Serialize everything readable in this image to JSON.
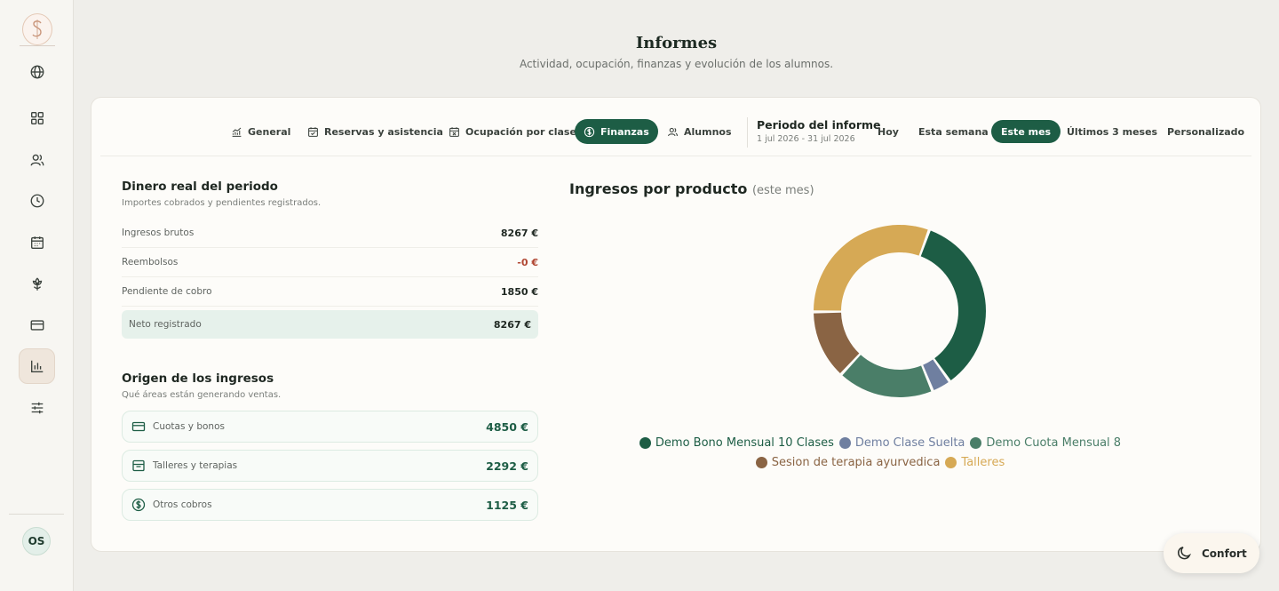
{
  "header": {
    "title": "Informes",
    "subtitle": "Actividad, ocupación, finanzas y evolución de los alumnos."
  },
  "sidebar": {
    "items": [
      {
        "icon": "globe-icon"
      },
      {
        "icon": "dashboard-icon"
      },
      {
        "icon": "users-icon"
      },
      {
        "icon": "clock-icon"
      },
      {
        "icon": "calendar-icon"
      },
      {
        "icon": "lotus-icon"
      },
      {
        "icon": "credit-card-icon"
      },
      {
        "icon": "bar-chart-icon",
        "active": true
      },
      {
        "icon": "sliders-icon"
      }
    ],
    "avatar": "OS"
  },
  "tabs": [
    {
      "label": "General",
      "icon": "trend-chart-icon"
    },
    {
      "label": "Reservas y asistencia",
      "icon": "calendar-check-icon"
    },
    {
      "label": "Ocupación por clase",
      "icon": "calendar-x-icon"
    },
    {
      "label": "Finanzas",
      "icon": "dollar-circle-icon",
      "active": true
    },
    {
      "label": "Alumnos",
      "icon": "users-icon"
    }
  ],
  "period": {
    "title": "Periodo del informe",
    "range": "1 jul 2026 - 31 jul 2026",
    "options": [
      "Hoy",
      "Esta semana",
      "Este mes",
      "Últimos 3 meses",
      "Personalizado"
    ],
    "selected": "Este mes"
  },
  "money": {
    "title": "Dinero real del periodo",
    "subtitle": "Importes cobrados y pendientes registrados.",
    "rows": [
      {
        "label": "Ingresos brutos",
        "value": "8267 €"
      },
      {
        "label": "Reembolsos",
        "value": "-0 €"
      },
      {
        "label": "Pendiente de cobro",
        "value": "1850 €"
      }
    ],
    "net": {
      "label": "Neto registrado",
      "value": "8267 €"
    }
  },
  "origin": {
    "title": "Origen de los ingresos",
    "subtitle": "Qué áreas están generando ventas.",
    "items": [
      {
        "label": "Cuotas y bonos",
        "value": "4850 €",
        "icon": "card-icon"
      },
      {
        "label": "Talleres y terapias",
        "value": "2292 €",
        "icon": "box-icon"
      },
      {
        "label": "Otros cobros",
        "value": "1125 €",
        "icon": "dollar-circle-icon"
      }
    ]
  },
  "chart": {
    "title": "Ingresos por producto",
    "note": "(este mes)"
  },
  "chart_data": {
    "type": "pie",
    "title": "Ingresos por producto",
    "categories": [
      "Demo Bono Mensual 10 Clases",
      "Demo Clase Suelta",
      "Demo Cuota Mensual 8",
      "Sesion de terapia ayurvedica",
      "Talleres"
    ],
    "values": [
      2580,
      270,
      1350,
      967,
      2292
    ],
    "colors": [
      "#1d5d45",
      "#6f7fa0",
      "#4a7e68",
      "#8a6444",
      "#d6a955"
    ],
    "legend": "bottom"
  },
  "confort": {
    "label": "Confort",
    "icon": "moon-icon"
  }
}
